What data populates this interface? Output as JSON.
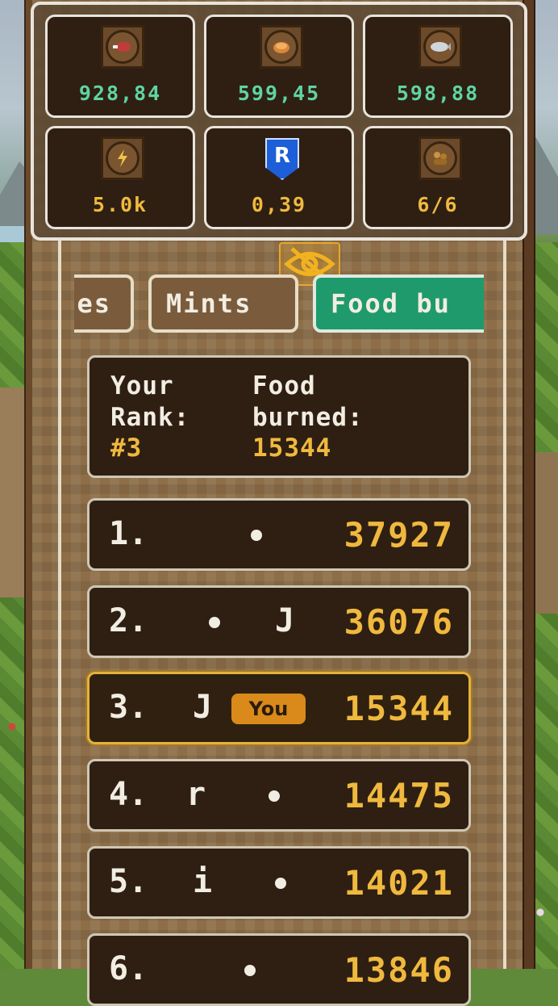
{
  "resources": [
    {
      "icon": "meat-icon",
      "value": "928,84",
      "color": "green"
    },
    {
      "icon": "bread-icon",
      "value": "599,45",
      "color": "green"
    },
    {
      "icon": "fish-icon",
      "value": "598,88",
      "color": "green"
    },
    {
      "icon": "energy-icon",
      "value": "5.0k",
      "color": "yellow"
    },
    {
      "icon": "ronin-shield-icon",
      "badge": "R",
      "value": "0,39",
      "color": "yellow"
    },
    {
      "icon": "workers-icon",
      "value": "6/6",
      "color": "yellow"
    }
  ],
  "tabs": [
    {
      "label": "es",
      "active": false
    },
    {
      "label": "Mints",
      "active": false
    },
    {
      "label": "Food bu",
      "active": true
    }
  ],
  "summary": {
    "rank_label_1": "Your",
    "rank_label_2": "Rank:",
    "rank_value": "#3",
    "food_label_1": "Food",
    "food_label_2": "burned:",
    "food_value": "15344"
  },
  "leaderboard": [
    {
      "rank": "1.",
      "name": "",
      "score": "37927",
      "you": false
    },
    {
      "rank": "2.",
      "name": "J",
      "score": "36076",
      "you": false
    },
    {
      "rank": "3.",
      "name": "J",
      "score": "15344",
      "you": true,
      "badge": "You"
    },
    {
      "rank": "4.",
      "name": "r",
      "score": "14475",
      "you": false
    },
    {
      "rank": "5.",
      "name": "i",
      "score": "14021",
      "you": false
    },
    {
      "rank": "6.",
      "name": "",
      "score": "13846",
      "you": false
    }
  ],
  "colors": {
    "accent_green": "#1f9a6c",
    "value_green": "#5fd4a3",
    "value_yellow": "#f0b93e",
    "card_bg": "#2e1f12",
    "you_badge": "#d98a1a"
  }
}
